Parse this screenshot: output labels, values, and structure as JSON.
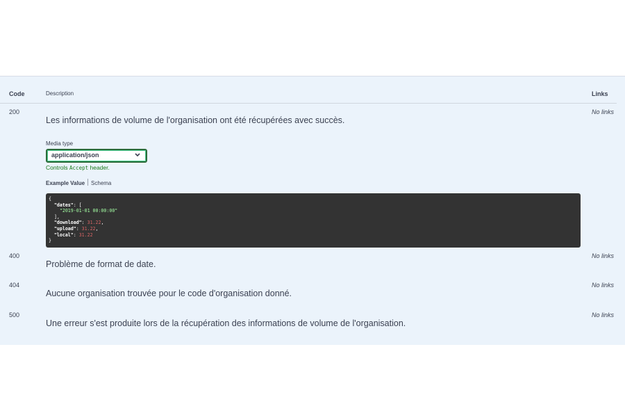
{
  "table": {
    "header": {
      "code": "Code",
      "description": "Description",
      "links": "Links"
    }
  },
  "responses": [
    {
      "code": "200",
      "description": "Les informations de volume de l'organisation ont été récupérées avec succès.",
      "links": "No links"
    },
    {
      "code": "400",
      "description": "Problème de format de date.",
      "links": "No links"
    },
    {
      "code": "404",
      "description": "Aucune organisation trouvée pour le code d'organisation donné.",
      "links": "No links"
    },
    {
      "code": "500",
      "description": "Une erreur s'est produite lors de la récupération des informations de volume de l'organisation.",
      "links": "No links"
    }
  ],
  "media_type": {
    "label": "Media type",
    "selected": "application/json",
    "controls_prefix": "Controls",
    "controls_code": "Accept",
    "controls_suffix": "header."
  },
  "example_tabs": {
    "example": "Example Value",
    "schema": "Schema"
  },
  "example": {
    "open_brace": "{",
    "dates_key": "\"dates\"",
    "dates_open": ": [",
    "dates_value": "\"2019-01-01 00:00:00\"",
    "dates_close": "],",
    "download_key": "\"download\"",
    "download_value": "31.22",
    "upload_key": "\"upload\"",
    "upload_value": "31.22",
    "local_key": "\"local\"",
    "local_value": "31.22",
    "close_brace": "}"
  },
  "colors": {
    "panel_bg": "#ebf3fb",
    "code_bg": "#333333",
    "string": "#a2fca2",
    "number": "#d36363",
    "controls_text": "#1a7a1a"
  }
}
